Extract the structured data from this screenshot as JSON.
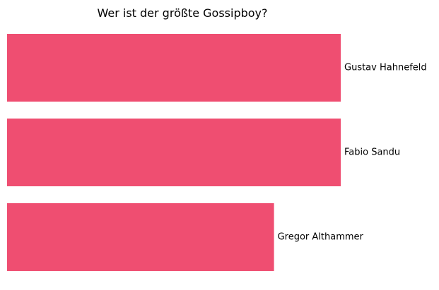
{
  "chart_data": {
    "type": "bar",
    "orientation": "horizontal",
    "title": "Wer ist der größte Gossipboy?",
    "categories": [
      "Gustav Hahnefeld",
      "Fabio Sandu",
      "Gregor Althammer"
    ],
    "values": [
      5,
      5,
      4
    ],
    "xlim": [
      0,
      5
    ],
    "grid": false,
    "axes_visible": false,
    "legend": "none",
    "bar_color": "#EF4E71",
    "label_placement": "end-of-bar"
  }
}
